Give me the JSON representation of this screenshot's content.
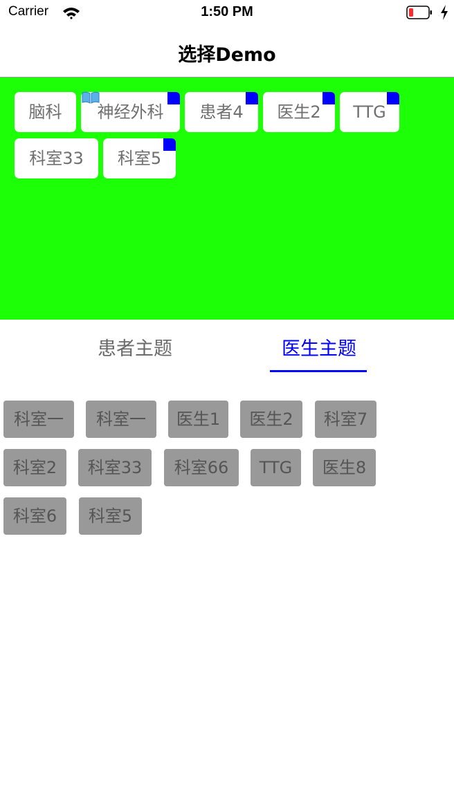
{
  "status_bar": {
    "carrier": "Carrier",
    "time": "1:50 PM"
  },
  "nav": {
    "title": "选择Demo"
  },
  "selected_tags": [
    {
      "label": "脑科",
      "corner": false,
      "book": false
    },
    {
      "label": "神经外科",
      "corner": true,
      "book": true
    },
    {
      "label": "患者4",
      "corner": true,
      "book": false
    },
    {
      "label": "医生2",
      "corner": true,
      "book": false
    },
    {
      "label": "TTG",
      "corner": true,
      "book": false
    },
    {
      "label": "科室33",
      "corner": false,
      "book": false
    },
    {
      "label": "科室5",
      "corner": true,
      "book": false
    }
  ],
  "tabs": [
    {
      "label": "患者主题",
      "active": false
    },
    {
      "label": "医生主题",
      "active": true
    }
  ],
  "tag_options": [
    "科室一",
    "科室一",
    "医生1",
    "医生2",
    "科室7",
    "科室2",
    "科室33",
    "科室66",
    "TTG",
    "医生8",
    "科室6",
    "科室5"
  ],
  "colors": {
    "selected_area_bg": "#1cff06",
    "accent": "#0000ff",
    "option_chip_bg": "#999999"
  }
}
